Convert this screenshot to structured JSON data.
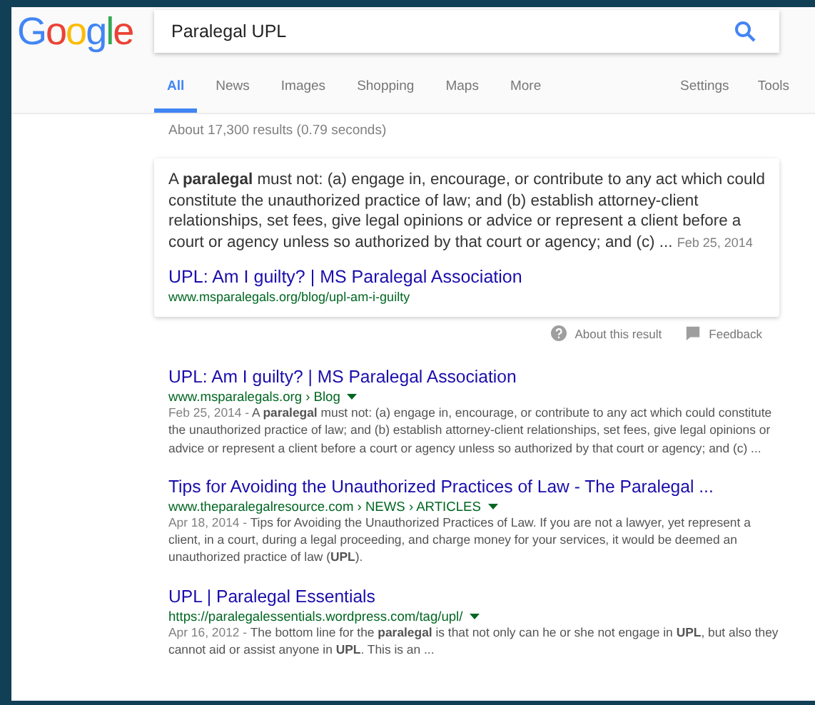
{
  "logo": "Google",
  "search": {
    "value": "Paralegal UPL"
  },
  "tabs": [
    {
      "label": "All",
      "selected": true
    },
    {
      "label": "News",
      "selected": false
    },
    {
      "label": "Images",
      "selected": false
    },
    {
      "label": "Shopping",
      "selected": false
    },
    {
      "label": "Maps",
      "selected": false
    },
    {
      "label": "More",
      "selected": false
    }
  ],
  "tools": [
    "Settings",
    "Tools"
  ],
  "result_stats": "About 17,300 results (0.79 seconds)",
  "featured_snippet": {
    "text": "A **paralegal** must not: (a) engage in, encourage, or contribute to any act which could constitute the unauthorized practice of law; and (b) establish attorney-client relationships, set fees, give legal opinions or advice or represent a client before a court or agency unless so authorized by that court or agency; and (c) ...",
    "date": "Feb 25, 2014",
    "title": "UPL: Am I guilty? | MS Paralegal Association",
    "url": "www.msparalegals.org/blog/upl-am-i-guilty"
  },
  "featured_footer": [
    "About this result",
    "Feedback"
  ],
  "results": [
    {
      "title": "UPL: Am I guilty? | MS Paralegal Association",
      "url": "www.msparalegals.org › Blog",
      "date": "Feb 25, 2014 - ",
      "snippet": "A **paralegal** must not: (a) engage in, encourage, or contribute to any act which could constitute the unauthorized practice of law; and (b) establish attorney-client relationships, set fees, give legal opinions or advice or represent a client before a court or agency unless so authorized by that court or agency; and (c) ..."
    },
    {
      "title": "Tips for Avoiding the Unauthorized Practices of Law - The Paralegal ...",
      "url": "www.theparalegalresource.com › NEWS › ARTICLES",
      "date": "Apr 18, 2014 - ",
      "snippet": "Tips for Avoiding the Unauthorized Practices of Law. If you are not a lawyer, yet represent a client, in a court, during a legal proceeding, and charge money for your services, it would be deemed an unauthorized practice of law (**UPL**)."
    },
    {
      "title": "UPL | Paralegal Essentials",
      "url": "https://paralegalessentials.wordpress.com/tag/upl/",
      "date": "Apr 16, 2012 - ",
      "snippet": "The bottom line for the **paralegal** is that not only can he or she not engage in **UPL**, but also they cannot aid or assist anyone in **UPL**. This is an ..."
    }
  ]
}
